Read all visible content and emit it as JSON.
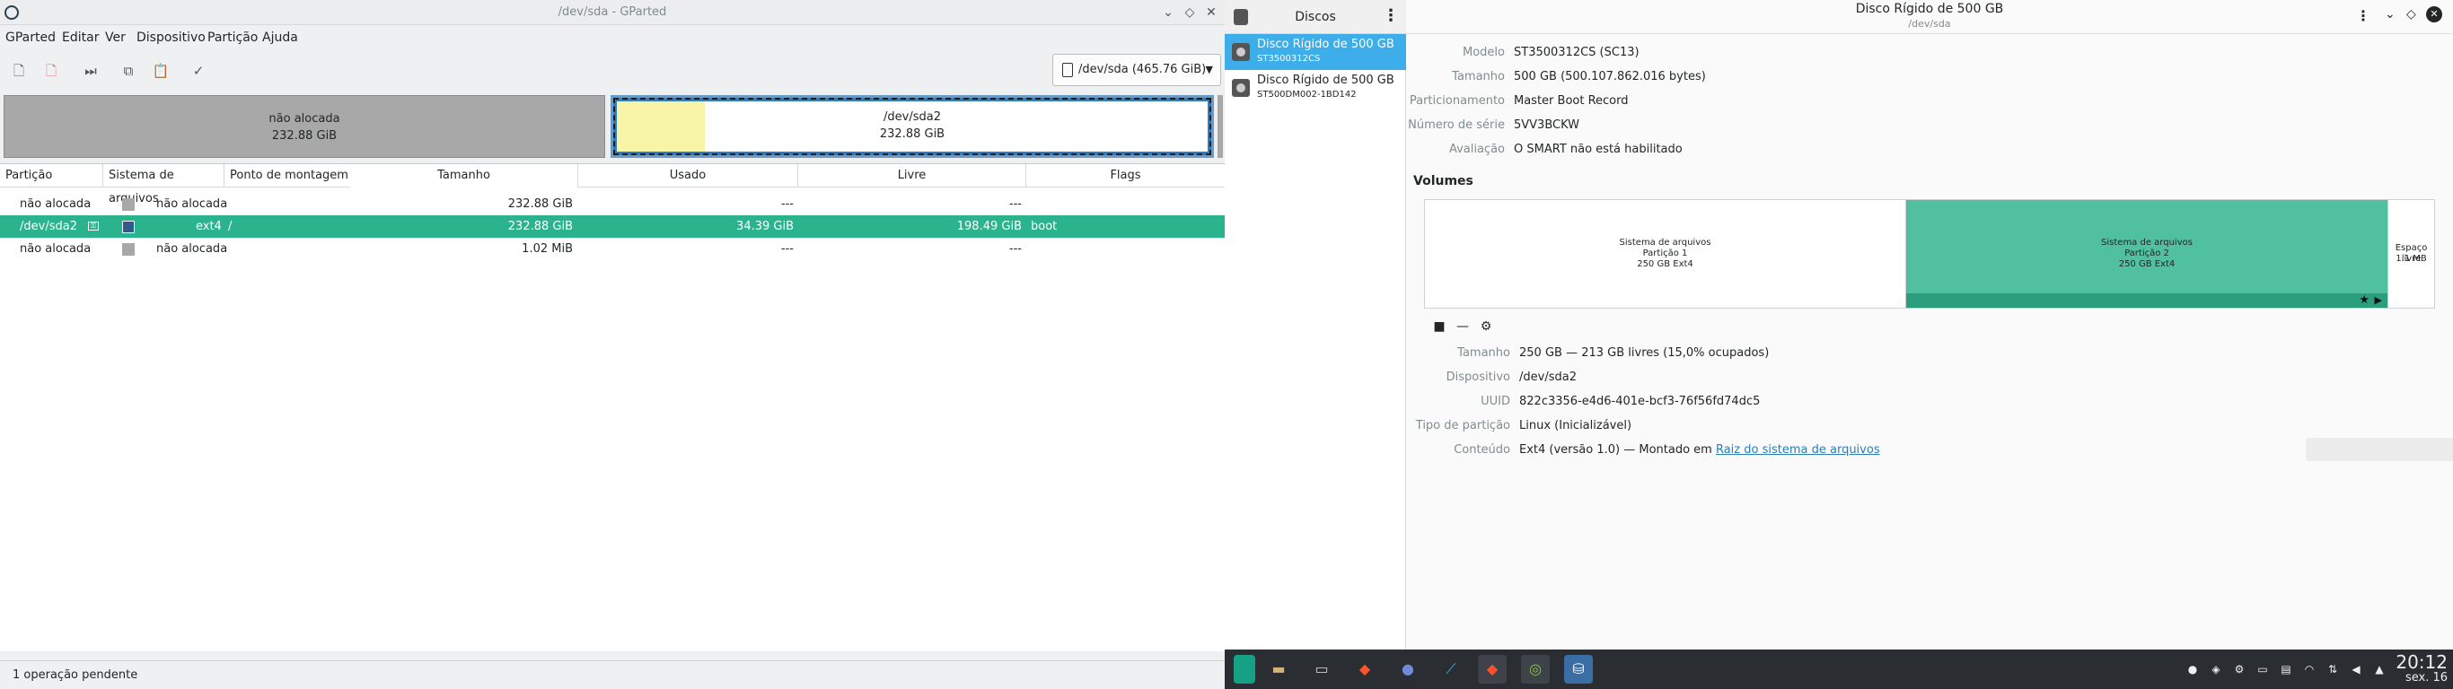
{
  "gparted": {
    "title": "/dev/sda - GParted",
    "menu": [
      "GParted",
      "Editar",
      "Ver",
      "Dispositivo",
      "Partição",
      "Ajuda"
    ],
    "device_selector": "/dev/sda (465.76 GiB)",
    "diskmap": {
      "unalloc_label": "não alocada",
      "unalloc_size": "232.88 GiB",
      "sda2_label": "/dev/sda2",
      "sda2_size": "232.88 GiB"
    },
    "columns": [
      "Partição",
      "Sistema de arquivos",
      "Ponto de montagem",
      "Tamanho",
      "Usado",
      "Livre",
      "Flags"
    ],
    "rows": [
      {
        "partition": "não alocada",
        "fs": "não alocada",
        "mount": "",
        "size": "232.88 GiB",
        "used": "---",
        "free": "---",
        "flags": "",
        "fs_color": "#a8a8a8"
      },
      {
        "partition": "/dev/sda2",
        "fs": "ext4",
        "mount": "/",
        "size": "232.88 GiB",
        "used": "34.39 GiB",
        "free": "198.49 GiB",
        "flags": "boot",
        "fs_color": "#2f5a8a"
      },
      {
        "partition": "não alocada",
        "fs": "não alocada",
        "mount": "",
        "size": "1.02 MiB",
        "used": "---",
        "free": "---",
        "flags": "",
        "fs_color": "#a8a8a8"
      }
    ],
    "status": "1 operação pendente"
  },
  "disks": {
    "sidebar_title": "Discos",
    "drives": [
      {
        "name": "Disco Rígido de 500 GB",
        "model": "ST3500312CS"
      },
      {
        "name": "Disco Rígido de 500 GB",
        "model": "ST500DM002-1BD142"
      }
    ],
    "header_title": "Disco Rígido de 500 GB",
    "header_subtitle": "/dev/sda",
    "info": [
      {
        "k": "Modelo",
        "v": "ST3500312CS (SC13)"
      },
      {
        "k": "Tamanho",
        "v": "500 GB (500.107.862.016 bytes)"
      },
      {
        "k": "Particionamento",
        "v": "Master Boot Record"
      },
      {
        "k": "Número de série",
        "v": "5VV3BCKW"
      },
      {
        "k": "Avaliação",
        "v": "O SMART não está habilitado"
      }
    ],
    "volumes_title": "Volumes",
    "vol1": [
      "Sistema de arquivos",
      "Partição 1",
      "250 GB Ext4"
    ],
    "vol2": [
      "Sistema de arquivos",
      "Partição 2",
      "250 GB Ext4"
    ],
    "vol3": [
      "Espaço livre",
      "1.1 MB"
    ],
    "details": [
      {
        "k": "Tamanho",
        "v": "250 GB — 213 GB livres (15,0% ocupados)"
      },
      {
        "k": "Dispositivo",
        "v": "/dev/sda2"
      },
      {
        "k": "UUID",
        "v": "822c3356-e4d6-401e-bcf3-76f56fd74dc5"
      },
      {
        "k": "Tipo de partição",
        "v": "Linux (Inicializável)"
      }
    ],
    "content_label": "Conteúdo",
    "content_prefix": "Ext4 (versão 1.0) — Montado em ",
    "content_link": "Raiz do sistema de arquivos"
  },
  "clock": {
    "time": "20:12",
    "date": "sex. 16"
  }
}
